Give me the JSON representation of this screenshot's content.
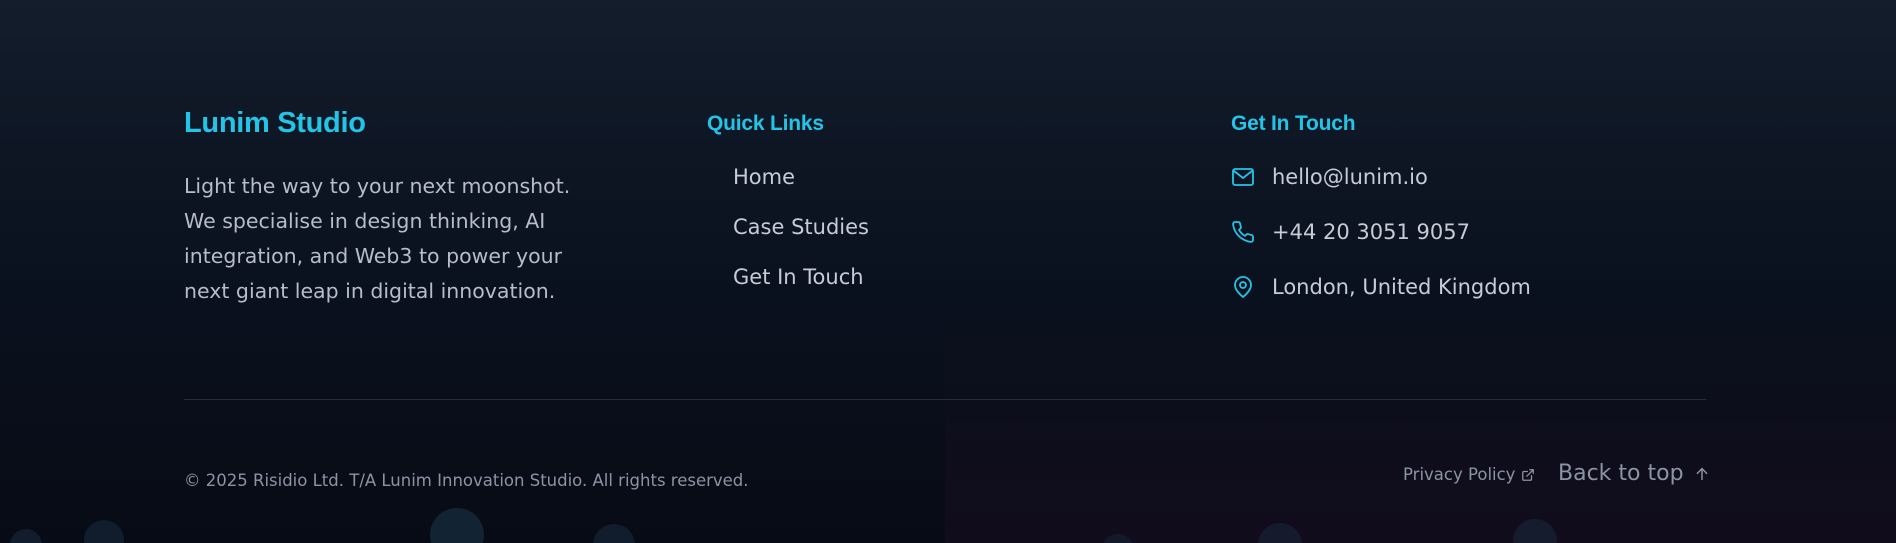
{
  "brand": {
    "title": "Lunim Studio",
    "description": "Light the way to your next moonshot. We specialise in design thinking, AI integration, and Web3 to power your next giant leap in digital innovation."
  },
  "quick_links": {
    "heading": "Quick Links",
    "items": [
      "Home",
      "Case Studies",
      "Get In Touch"
    ]
  },
  "contact": {
    "heading": "Get In Touch",
    "email": {
      "icon": "mail-icon",
      "text": "hello@lunim.io"
    },
    "phone": {
      "icon": "phone-icon",
      "text": "+44 20 3051 9057"
    },
    "location": {
      "icon": "map-pin-icon",
      "text": "London, United Kingdom"
    }
  },
  "bottom": {
    "copyright": "© 2025 Risidio Ltd. T/A Lunim Innovation Studio. All rights reserved.",
    "privacy_label": "Privacy Policy",
    "privacy_icon": "external-link-icon",
    "back_to_top_label": "Back to top",
    "back_to_top_icon": "arrow-up-icon"
  },
  "colors": {
    "accent": "#22c5e8",
    "text": "#c6ccd5",
    "muted": "#8b94a3",
    "background": "#0b1220"
  }
}
